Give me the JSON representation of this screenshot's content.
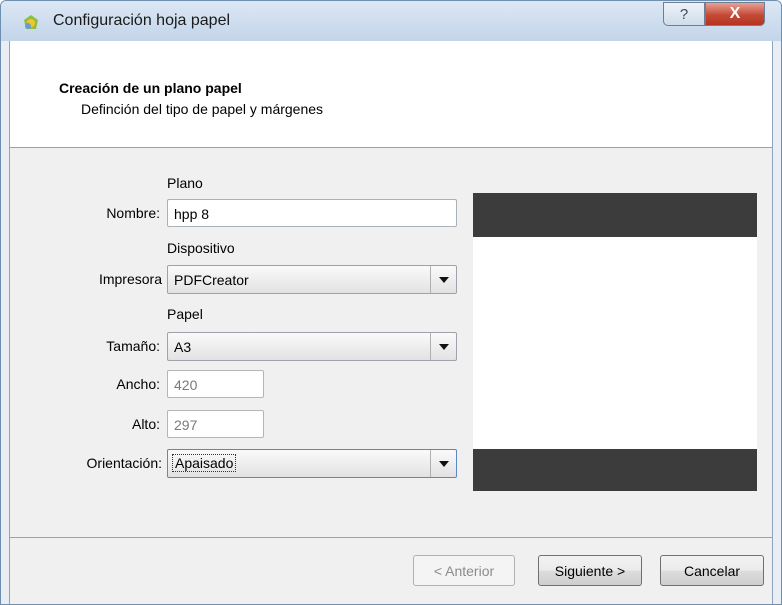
{
  "window": {
    "title": "Configuración hoja papel",
    "help_label": "?",
    "close_label": "X"
  },
  "header": {
    "title": "Creación de un plano papel",
    "subtitle": "Definción del tipo de papel y márgenes"
  },
  "form": {
    "plano_section": "Plano",
    "nombre_label": "Nombre:",
    "nombre_value": "hpp 8",
    "dispositivo_section": "Dispositivo",
    "impresora_label": "Impresora",
    "impresora_value": "PDFCreator",
    "papel_section": "Papel",
    "tamano_label": "Tamaño:",
    "tamano_value": "A3",
    "ancho_label": "Ancho:",
    "ancho_value": "420",
    "alto_label": "Alto:",
    "alto_value": "297",
    "orientacion_label": "Orientación:",
    "orientacion_value": "Apaisado"
  },
  "buttons": {
    "back": "< Anterior",
    "next": "Siguiente >",
    "cancel": "Cancelar"
  },
  "colors": {
    "preview_band": "#3c3c3c",
    "close_button": "#c44a35"
  },
  "icons": {
    "app": "qgis-icon",
    "help": "help-icon",
    "close": "close-icon",
    "dropdown": "chevron-down-icon"
  }
}
